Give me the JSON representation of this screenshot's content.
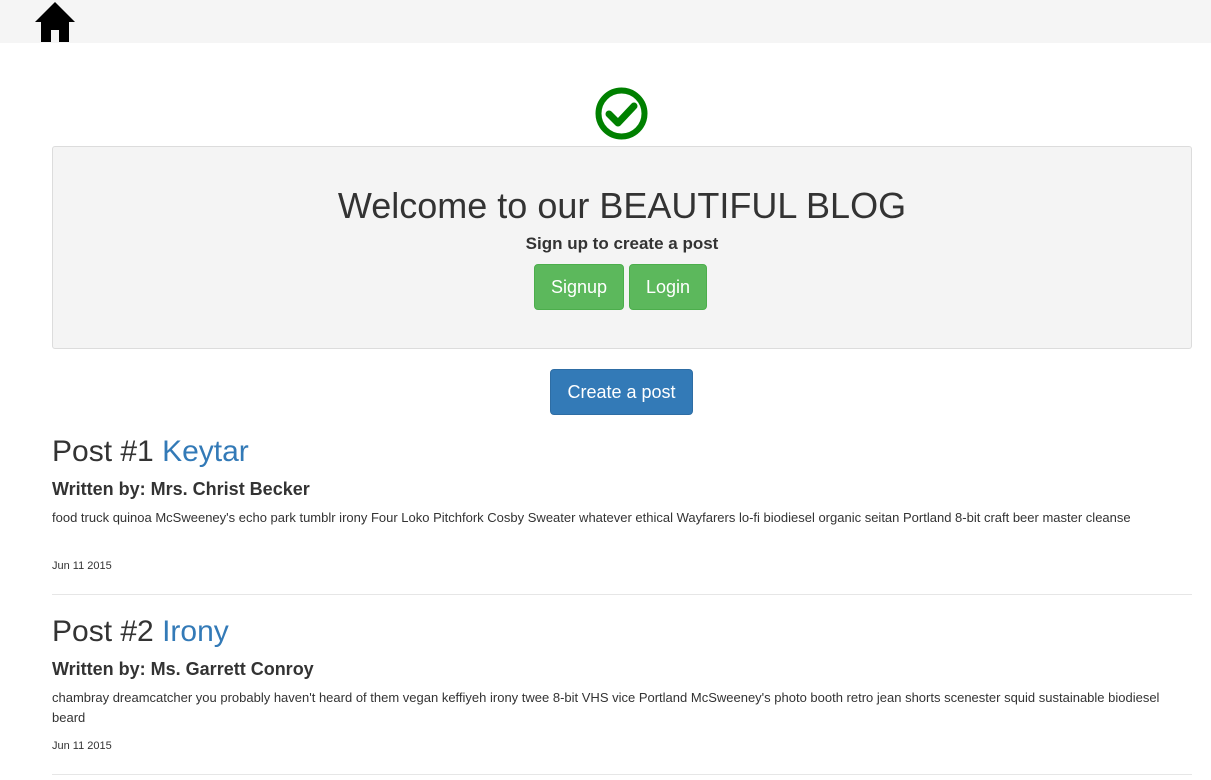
{
  "nav": {
    "home_icon": "home-icon"
  },
  "status": {
    "icon": "check-circle-icon",
    "color": "#008000"
  },
  "jumbotron": {
    "title": "Welcome to our BEAUTIFUL BLOG",
    "subtitle": "Sign up to create a post",
    "signup_label": "Signup",
    "login_label": "Login"
  },
  "create_post_label": "Create a post",
  "posts": [
    {
      "number_label": "Post #1",
      "title": "Keytar",
      "author": "Written by: Mrs. Christ Becker",
      "body": "food truck quinoa McSweeney's echo park tumblr irony Four Loko Pitchfork Cosby Sweater whatever ethical Wayfarers lo-fi biodiesel organic seitan Portland 8-bit craft beer master cleanse",
      "date": "Jun 11 2015"
    },
    {
      "number_label": "Post #2",
      "title": "Irony",
      "author": "Written by: Ms. Garrett Conroy",
      "body": "chambray dreamcatcher you probably haven't heard of them vegan keffiyeh irony twee 8-bit VHS vice Portland McSweeney's photo booth retro jean shorts scenester squid sustainable biodiesel beard",
      "date": "Jun 11 2015"
    }
  ],
  "colors": {
    "success": "#5cb85c",
    "primary": "#337ab7",
    "link": "#337ab7",
    "jumbotron_bg": "#f4f4f4"
  }
}
